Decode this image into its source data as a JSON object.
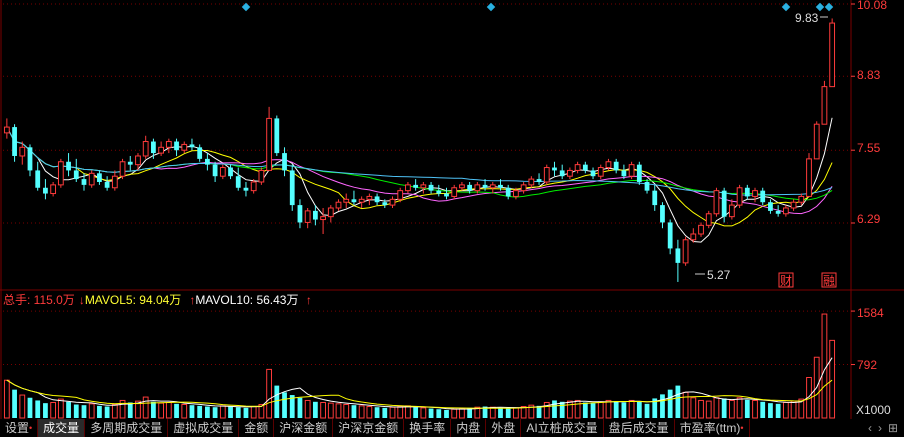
{
  "price_axis": {
    "ticks": [
      "10.08",
      "8.83",
      "7.55",
      "6.29"
    ],
    "max_label": "9.83",
    "min_label": "5.27"
  },
  "events": {
    "cai": "财",
    "rongzhang": "融"
  },
  "volume": {
    "total_label": "总手: 115.0万",
    "mavol5_label": "MAVOL5: 94.04万",
    "mavol10_label": "MAVOL10: 56.43万",
    "ticks": [
      "1584",
      "792",
      "X1000"
    ]
  },
  "tabs": [
    "设置",
    "成交量",
    "多周期成交量",
    "虚拟成交量",
    "金额",
    "沪深金额",
    "沪深京金额",
    "换手率",
    "内盘",
    "外盘",
    "AI立桩成交量",
    "盘后成交量",
    "市盈率(ttm)"
  ],
  "active_tab": 1,
  "colors": {
    "up": "#ff3b3b",
    "down": "#54ffff",
    "ma5": "#ffffff",
    "ma10": "#ffff00",
    "ma20": "#ff66ff",
    "ma30": "#00ee00",
    "ma60": "#4fc3f7",
    "grid": "#7a0000"
  },
  "chart_data": {
    "type": "candlestick",
    "y_axis": {
      "min": 5.2,
      "max": 10.08,
      "ticks": [
        6.29,
        7.55,
        8.83,
        10.08
      ]
    },
    "max_annotation": 9.83,
    "min_annotation": 5.27,
    "ohlc": [
      [
        7.85,
        8.1,
        7.75,
        7.95
      ],
      [
        7.95,
        8.0,
        7.35,
        7.45
      ],
      [
        7.45,
        7.7,
        7.3,
        7.6
      ],
      [
        7.6,
        7.65,
        7.1,
        7.2
      ],
      [
        7.2,
        7.35,
        6.85,
        6.9
      ],
      [
        6.9,
        7.05,
        6.7,
        6.8
      ],
      [
        6.8,
        7.0,
        6.75,
        6.95
      ],
      [
        6.95,
        7.4,
        6.9,
        7.35
      ],
      [
        7.35,
        7.5,
        7.1,
        7.2
      ],
      [
        7.2,
        7.4,
        7.0,
        7.05
      ],
      [
        7.05,
        7.15,
        6.85,
        6.95
      ],
      [
        6.95,
        7.2,
        6.9,
        7.15
      ],
      [
        7.15,
        7.2,
        6.95,
        7.0
      ],
      [
        7.0,
        7.1,
        6.85,
        6.9
      ],
      [
        6.9,
        7.2,
        6.85,
        7.1
      ],
      [
        7.1,
        7.4,
        7.05,
        7.35
      ],
      [
        7.35,
        7.45,
        7.2,
        7.3
      ],
      [
        7.3,
        7.5,
        7.2,
        7.45
      ],
      [
        7.45,
        7.8,
        7.4,
        7.7
      ],
      [
        7.7,
        7.75,
        7.4,
        7.5
      ],
      [
        7.5,
        7.7,
        7.45,
        7.6
      ],
      [
        7.6,
        7.75,
        7.5,
        7.7
      ],
      [
        7.7,
        7.75,
        7.45,
        7.55
      ],
      [
        7.55,
        7.7,
        7.5,
        7.65
      ],
      [
        7.65,
        7.75,
        7.55,
        7.6
      ],
      [
        7.6,
        7.65,
        7.35,
        7.4
      ],
      [
        7.4,
        7.5,
        7.2,
        7.3
      ],
      [
        7.3,
        7.35,
        7.0,
        7.1
      ],
      [
        7.1,
        7.3,
        7.05,
        7.25
      ],
      [
        7.25,
        7.3,
        7.05,
        7.1
      ],
      [
        7.1,
        7.25,
        6.85,
        6.9
      ],
      [
        6.9,
        7.0,
        6.75,
        6.85
      ],
      [
        6.85,
        7.05,
        6.8,
        7.0
      ],
      [
        7.0,
        7.25,
        6.95,
        7.2
      ],
      [
        7.2,
        8.3,
        7.2,
        8.1
      ],
      [
        8.1,
        8.15,
        7.45,
        7.5
      ],
      [
        7.5,
        7.6,
        7.1,
        7.2
      ],
      [
        7.2,
        7.3,
        6.5,
        6.6
      ],
      [
        6.6,
        6.7,
        6.2,
        6.3
      ],
      [
        6.3,
        6.55,
        6.2,
        6.5
      ],
      [
        6.5,
        6.6,
        6.25,
        6.35
      ],
      [
        6.35,
        6.55,
        6.1,
        6.4
      ],
      [
        6.4,
        6.6,
        6.3,
        6.55
      ],
      [
        6.55,
        6.7,
        6.5,
        6.65
      ],
      [
        6.65,
        6.8,
        6.55,
        6.7
      ],
      [
        6.7,
        6.85,
        6.6,
        6.65
      ],
      [
        6.65,
        6.75,
        6.55,
        6.7
      ],
      [
        6.7,
        6.8,
        6.6,
        6.75
      ],
      [
        6.75,
        6.8,
        6.6,
        6.65
      ],
      [
        6.65,
        6.7,
        6.55,
        6.6
      ],
      [
        6.6,
        6.75,
        6.55,
        6.7
      ],
      [
        6.7,
        6.9,
        6.65,
        6.85
      ],
      [
        6.85,
        7.0,
        6.8,
        6.95
      ],
      [
        6.95,
        7.05,
        6.85,
        6.9
      ],
      [
        6.9,
        7.0,
        6.8,
        6.95
      ],
      [
        6.95,
        7.0,
        6.8,
        6.85
      ],
      [
        6.85,
        6.95,
        6.75,
        6.8
      ],
      [
        6.8,
        6.9,
        6.7,
        6.75
      ],
      [
        6.75,
        6.95,
        6.7,
        6.9
      ],
      [
        6.9,
        7.0,
        6.85,
        6.95
      ],
      [
        6.95,
        7.0,
        6.8,
        6.85
      ],
      [
        6.85,
        7.0,
        6.8,
        6.95
      ],
      [
        6.95,
        7.05,
        6.85,
        6.9
      ],
      [
        6.9,
        7.0,
        6.8,
        6.95
      ],
      [
        6.95,
        7.05,
        6.85,
        6.9
      ],
      [
        6.9,
        6.95,
        6.7,
        6.75
      ],
      [
        6.75,
        6.9,
        6.7,
        6.85
      ],
      [
        6.85,
        7.0,
        6.8,
        6.95
      ],
      [
        6.95,
        7.1,
        6.9,
        7.05
      ],
      [
        7.05,
        7.15,
        6.95,
        7.0
      ],
      [
        7.0,
        7.3,
        6.95,
        7.25
      ],
      [
        7.25,
        7.35,
        7.1,
        7.2
      ],
      [
        7.2,
        7.3,
        7.05,
        7.1
      ],
      [
        7.1,
        7.25,
        7.05,
        7.2
      ],
      [
        7.2,
        7.35,
        7.15,
        7.3
      ],
      [
        7.3,
        7.35,
        7.15,
        7.2
      ],
      [
        7.2,
        7.25,
        7.05,
        7.1
      ],
      [
        7.1,
        7.3,
        7.05,
        7.25
      ],
      [
        7.25,
        7.4,
        7.2,
        7.35
      ],
      [
        7.35,
        7.4,
        7.15,
        7.2
      ],
      [
        7.2,
        7.3,
        7.05,
        7.1
      ],
      [
        7.1,
        7.35,
        7.05,
        7.3
      ],
      [
        7.3,
        7.35,
        6.95,
        7.0
      ],
      [
        7.0,
        7.05,
        6.8,
        6.85
      ],
      [
        6.85,
        6.95,
        6.5,
        6.6
      ],
      [
        6.6,
        6.65,
        6.2,
        6.3
      ],
      [
        6.3,
        6.35,
        5.75,
        5.85
      ],
      [
        5.85,
        6.0,
        5.27,
        5.6
      ],
      [
        5.6,
        6.05,
        5.55,
        6.0
      ],
      [
        6.0,
        6.2,
        5.95,
        6.1
      ],
      [
        6.1,
        6.3,
        6.05,
        6.25
      ],
      [
        6.25,
        6.5,
        6.2,
        6.45
      ],
      [
        6.45,
        6.9,
        6.4,
        6.85
      ],
      [
        6.85,
        6.9,
        6.3,
        6.4
      ],
      [
        6.4,
        6.7,
        6.35,
        6.6
      ],
      [
        6.6,
        6.95,
        6.55,
        6.9
      ],
      [
        6.9,
        6.95,
        6.7,
        6.75
      ],
      [
        6.75,
        6.9,
        6.65,
        6.85
      ],
      [
        6.85,
        6.9,
        6.6,
        6.65
      ],
      [
        6.65,
        6.7,
        6.45,
        6.5
      ],
      [
        6.5,
        6.6,
        6.4,
        6.45
      ],
      [
        6.45,
        6.6,
        6.4,
        6.55
      ],
      [
        6.55,
        6.7,
        6.5,
        6.65
      ],
      [
        6.65,
        6.8,
        6.6,
        6.75
      ],
      [
        6.75,
        7.5,
        6.75,
        7.4
      ],
      [
        7.4,
        8.05,
        7.4,
        8.0
      ],
      [
        8.0,
        8.75,
        8.0,
        8.65
      ],
      [
        8.65,
        9.83,
        8.65,
        9.75
      ]
    ],
    "volume": [
      560,
      420,
      340,
      300,
      260,
      220,
      230,
      280,
      240,
      200,
      190,
      210,
      180,
      170,
      200,
      260,
      230,
      250,
      310,
      240,
      220,
      230,
      210,
      200,
      190,
      180,
      170,
      160,
      180,
      170,
      160,
      150,
      170,
      200,
      720,
      480,
      380,
      340,
      300,
      260,
      240,
      230,
      220,
      210,
      200,
      190,
      180,
      170,
      160,
      150,
      160,
      170,
      180,
      160,
      150,
      140,
      130,
      120,
      130,
      140,
      150,
      160,
      170,
      160,
      150,
      140,
      150,
      170,
      190,
      180,
      230,
      260,
      240,
      250,
      260,
      230,
      220,
      240,
      260,
      250,
      230,
      260,
      240,
      210,
      290,
      350,
      420,
      480,
      380,
      300,
      260,
      250,
      300,
      290,
      260,
      300,
      270,
      260,
      240,
      220,
      210,
      230,
      250,
      280,
      600,
      900,
      1540,
      1150
    ]
  }
}
